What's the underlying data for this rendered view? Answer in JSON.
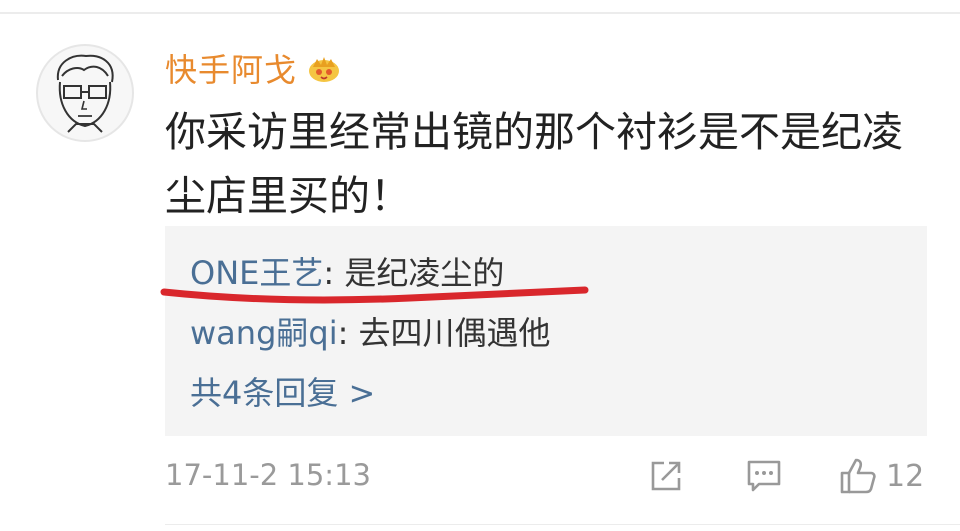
{
  "comment": {
    "username": "快手阿戈",
    "vip_badge": "crown-icon",
    "text": "你采访里经常出镜的那个衬衫是不是纪凌尘店里买的！",
    "timestamp": "17-11-2 15:13",
    "like_count": "12"
  },
  "replies": [
    {
      "user": "ONE王艺",
      "separator": ": ",
      "text": "是纪凌尘的"
    },
    {
      "user": "wang嗣qi",
      "separator": ": ",
      "text": "去四川偶遇他"
    }
  ],
  "more_replies_label": "共4条回复 >",
  "colors": {
    "username": "#e88a2e",
    "link": "#4a6f95",
    "highlight": "#d9272c",
    "reply_bg": "#f4f4f4"
  },
  "icons": {
    "share": "share-icon",
    "comment": "comment-icon",
    "like": "thumbs-up-icon"
  }
}
